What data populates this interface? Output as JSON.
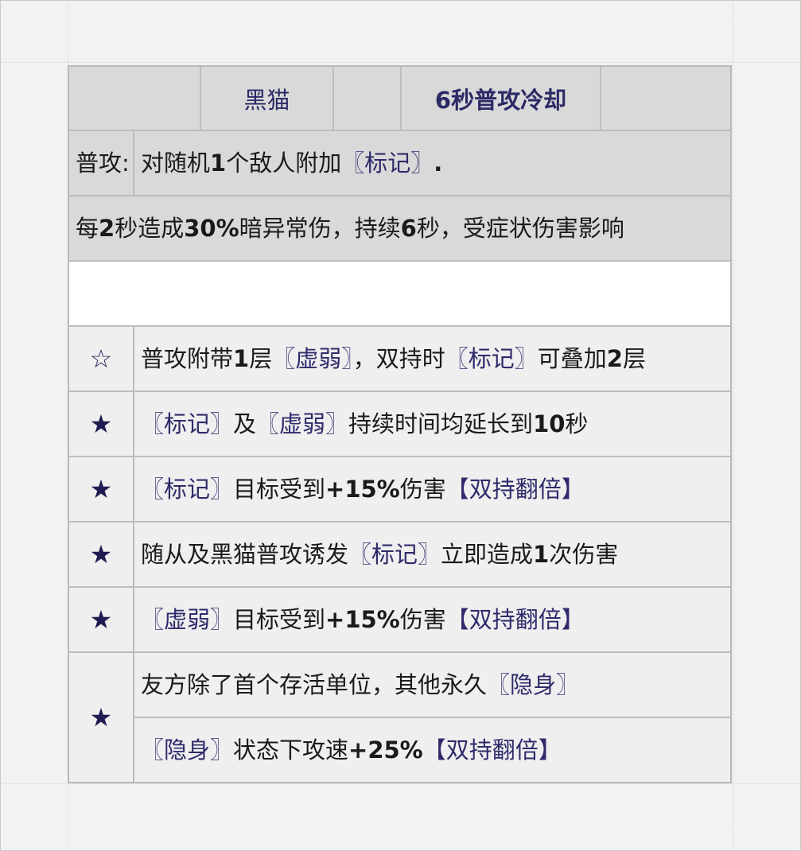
{
  "header": {
    "name_label": "黑猫",
    "cooldown_label": "6秒普攻冷却"
  },
  "basic_attack": {
    "label": "普攻:",
    "desc_prefix": "对随机",
    "desc_num": "1",
    "desc_middle": "个敌人附加",
    "desc_tag": "〖标记〗",
    "desc_suffix": "."
  },
  "mark_effect": {
    "p1": "每",
    "n1": "2",
    "p2": "秒造成",
    "n2": "30%",
    "p3": "暗异常伤，持续",
    "n3": "6",
    "p4": "秒，受症状伤害影响"
  },
  "upgrades": [
    {
      "icon": "star-outline-icon",
      "icon_glyph": "☆",
      "parts": [
        "普攻附带",
        "1",
        "层",
        "〖虚弱〗",
        "，双持时",
        "〖标记〗",
        "可叠加",
        "2",
        "层"
      ]
    },
    {
      "icon": "star-filled-icon",
      "icon_glyph": "★",
      "parts": [
        "〖标记〗",
        "及",
        "〖虚弱〗",
        "持续时间均延长到",
        "10",
        "秒"
      ]
    },
    {
      "icon": "star-filled-icon",
      "icon_glyph": "★",
      "parts": [
        "〖标记〗",
        "目标受到",
        "+15%",
        "伤害",
        "【双持翻倍】"
      ]
    },
    {
      "icon": "star-filled-icon",
      "icon_glyph": "★",
      "parts": [
        "随从及黑猫普攻诱发",
        "〖标记〗",
        "立即造成",
        "1",
        "次伤害"
      ]
    },
    {
      "icon": "star-filled-icon",
      "icon_glyph": "★",
      "parts": [
        "〖虚弱〗",
        "目标受到",
        "+15%",
        "伤害",
        "【双持翻倍】"
      ]
    },
    {
      "icon": "star-filled-icon",
      "icon_glyph": "★",
      "line1": [
        "友方除了首个存活单位，其他永久",
        "〖隐身〗"
      ],
      "line2": [
        "〖隐身〗",
        "状态下攻速",
        "+25%",
        "【双持翻倍】"
      ]
    }
  ],
  "colors": {
    "accent_text": "#2b2a66",
    "header_bg": "#d9d9d9",
    "row_bg": "#efefef",
    "border": "#bdbdbd"
  }
}
